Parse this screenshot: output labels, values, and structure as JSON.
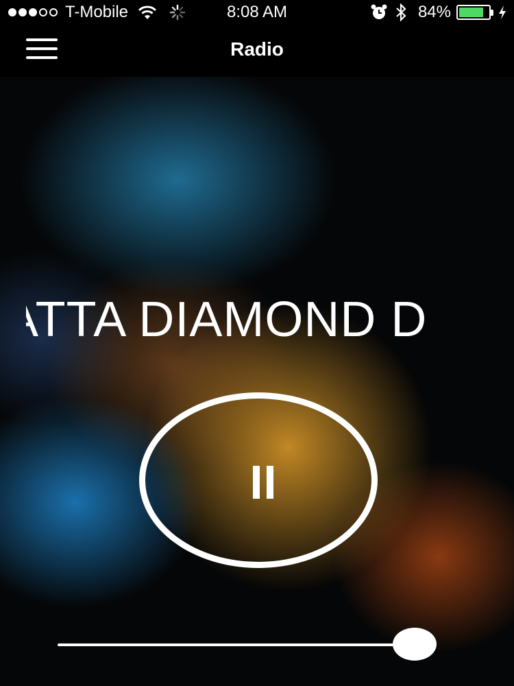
{
  "status_bar": {
    "signal_bars": [
      true,
      true,
      true,
      false,
      false
    ],
    "carrier": "T-Mobile",
    "time": "8:08 AM",
    "battery_percent_label": "84%",
    "battery_level": 0.84,
    "icons": [
      "wifi-icon",
      "activity-spinner-icon",
      "alarm-icon",
      "bluetooth-icon",
      "battery-icon",
      "charging-icon"
    ]
  },
  "nav": {
    "title": "Radio",
    "menu_icon": "hamburger-menu-icon"
  },
  "player": {
    "now_playing": "ATTA DIAMOND D",
    "state_icon": "pause-icon",
    "volume_level": 0.93
  },
  "colors": {
    "battery_fill": "#4cd964",
    "background": "#000000",
    "foreground": "#ffffff"
  }
}
